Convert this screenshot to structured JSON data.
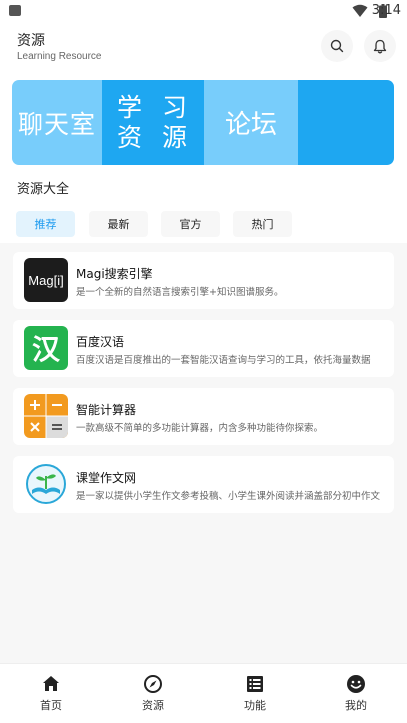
{
  "status_bar": {
    "time": "3:14"
  },
  "header": {
    "title": "资源",
    "subtitle": "Learning Resource"
  },
  "banner": {
    "segments": [
      "聊天室",
      "学 习",
      "资 源",
      "论坛"
    ]
  },
  "section": {
    "title": "资源大全"
  },
  "tabs": [
    {
      "label": "推荐"
    },
    {
      "label": "最新"
    },
    {
      "label": "官方"
    },
    {
      "label": "热门"
    }
  ],
  "resources": [
    {
      "name": "Magi搜索引擎",
      "desc": "是一个全新的自然语言搜索引擎+知识图谱服务。",
      "logo_text": "Mag[i]"
    },
    {
      "name": "百度汉语",
      "desc": "百度汉语是百度推出的一套智能汉语查询与学习的工具，依托海量数据",
      "logo_text": "汉"
    },
    {
      "name": "智能计算器",
      "desc": "一款高级不简单的多功能计算器，内含多种功能待你探索。",
      "logo_text": "+−×="
    },
    {
      "name": "课堂作文网",
      "desc": "是一家以提供小学生作文参考投稿、小学生课外阅读并涵盖部分初中作文",
      "logo_text": ""
    }
  ],
  "bottom_nav": [
    {
      "label": "首页"
    },
    {
      "label": "资源"
    },
    {
      "label": "功能"
    },
    {
      "label": "我的"
    }
  ],
  "colors": {
    "accent": "#1ea7f1",
    "accent_light": "#78cdfb",
    "tab_active_bg": "#e3f3fd",
    "tab_active_text": "#1e9bef"
  }
}
